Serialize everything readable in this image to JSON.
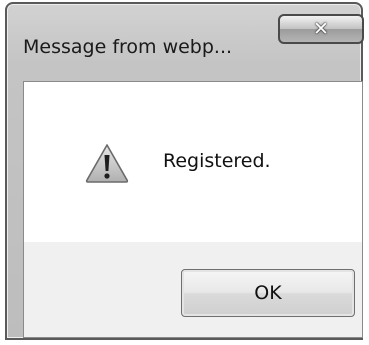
{
  "dialog": {
    "title": "Message from webp...",
    "close_icon": "close-icon",
    "message": "Registered.",
    "message_icon": "warning-icon",
    "ok_label": "OK"
  }
}
